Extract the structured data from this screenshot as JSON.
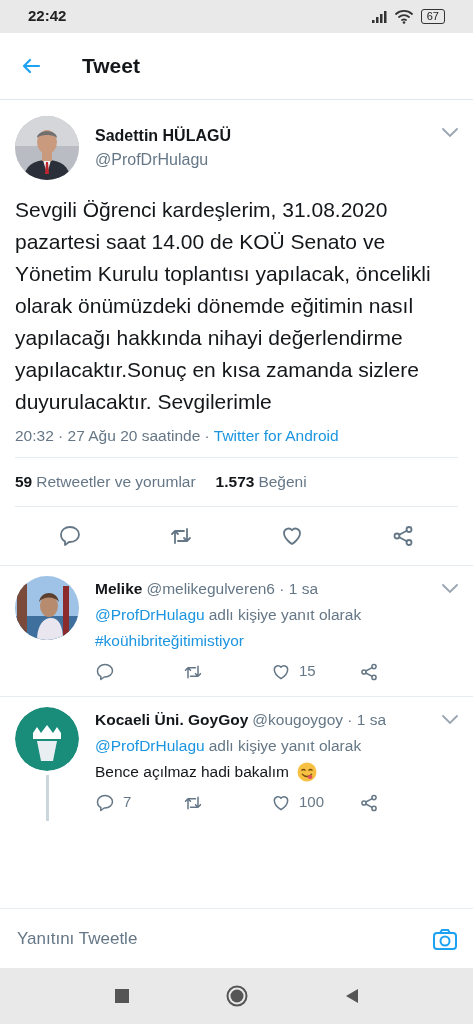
{
  "status_bar": {
    "time": "22:42",
    "battery": "67"
  },
  "header": {
    "title": "Tweet"
  },
  "tweet": {
    "name": "Sadettin HÜLAGÜ",
    "handle": "@ProfDrHulagu",
    "text": "Sevgili Öğrenci kardeşlerim, 31.08.2020 pazartesi saat 14.00 de KOÜ Senato ve Yönetim Kurulu toplantısı yapılacak, öncelikli olarak önümüzdeki dönemde eğitimin nasıl yapılacağı hakkında nihayi değerlendirme yapılacaktır.Sonuç en kısa zamanda sizlere duyurulacaktır. Sevgilerimle",
    "timestamp": "20:32 · 27 Ağu 20 saatinde ·",
    "source": "Twitter for Android",
    "retweets_count": "59",
    "retweets_label": "Retweetler ve yorumlar",
    "likes_count": "1.573",
    "likes_label": "Beğeni"
  },
  "replies": [
    {
      "name": "Melike",
      "handle": "@melikegulveren6 · 1 sa",
      "reply_to_handle": "@ProfDrHulagu",
      "reply_to_text": "adlı kişiye yanıt olarak",
      "text": "#koühibriteğitimistiyor",
      "hashtag": true,
      "emoji": false,
      "likes": "15",
      "thread_line": false
    },
    {
      "kind": "logo",
      "name": "Kocaeli Üni. GoyGoy",
      "handle": "@kougoygoy · 1 sa",
      "reply_to_handle": "@ProfDrHulagu",
      "reply_to_text": "adlı kişiye yanıt olarak",
      "text": "Bence açılmaz hadi bakalım",
      "hashtag": false,
      "emoji": true,
      "comments": "7",
      "likes": "100",
      "thread_line": true
    }
  ],
  "reply_bar": {
    "placeholder": "Yanıtını Tweetle"
  }
}
